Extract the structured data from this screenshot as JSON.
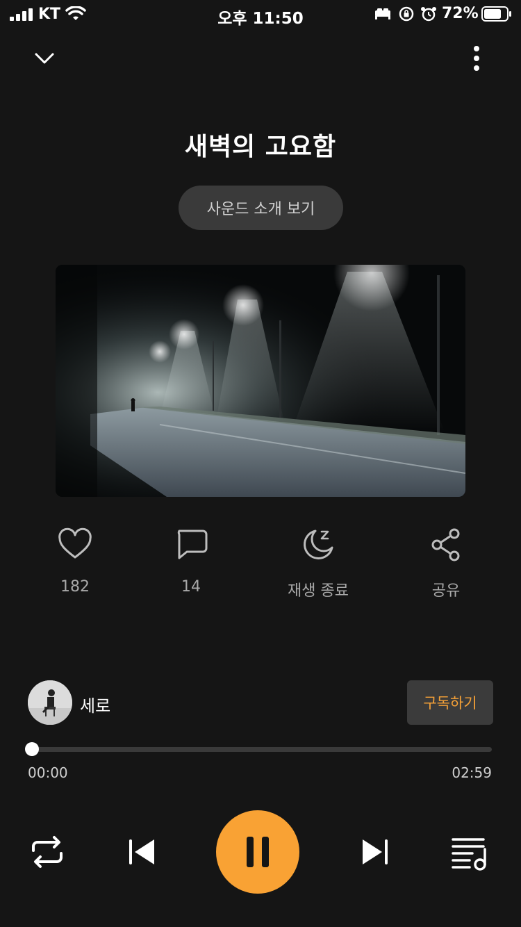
{
  "status_bar": {
    "carrier": "KT",
    "time": "오후 11:50",
    "battery": "72%"
  },
  "header": {
    "collapse_icon": "chevron-down-icon",
    "menu_icon": "more-vertical-icon"
  },
  "track": {
    "title": "새벽의 고요함",
    "intro_label": "사운드 소개 보기"
  },
  "actions": [
    {
      "icon": "heart-icon",
      "label": "182"
    },
    {
      "icon": "comment-icon",
      "label": "14"
    },
    {
      "icon": "sleep-timer-icon",
      "label": "재생 종료"
    },
    {
      "icon": "share-icon",
      "label": "공유"
    }
  ],
  "artist": {
    "name": "세로",
    "subscribe_label": "구독하기"
  },
  "progress": {
    "current": "00:00",
    "total": "02:59",
    "fraction": 0.0
  },
  "controls": {
    "repeat_icon": "repeat-icon",
    "prev_icon": "skip-previous-icon",
    "play_pause_icon": "pause-icon",
    "next_icon": "skip-next-icon",
    "playlist_icon": "playlist-icon"
  },
  "colors": {
    "background": "#151515",
    "accent": "#f9a234",
    "subscribe_text": "#f6a137"
  }
}
